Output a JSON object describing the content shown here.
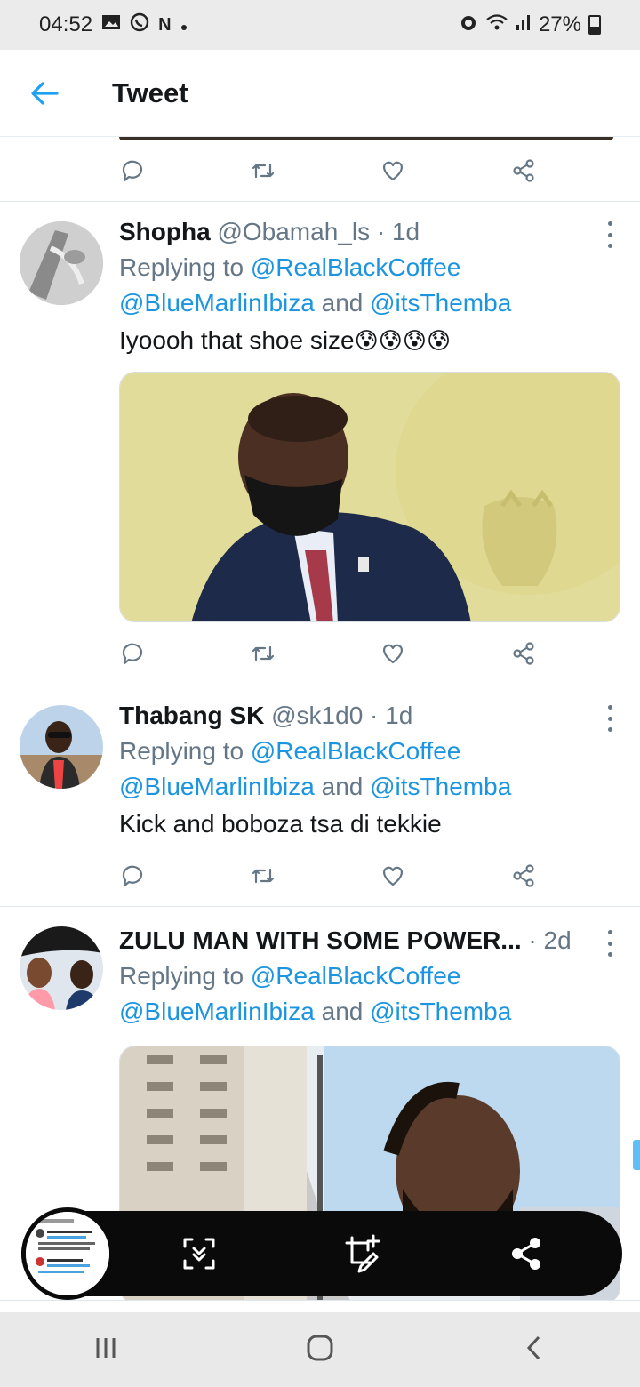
{
  "status": {
    "time": "04:52",
    "battery": "27%",
    "notif_letter": "N"
  },
  "header": {
    "title": "Tweet"
  },
  "tweets": [
    {
      "name": "Shopha",
      "handle": "@Obamah_ls",
      "time": "· 1d",
      "reply_prefix": "Replying to",
      "mention1": "@RealBlackCoffee",
      "mention2": "@BlueMarlinIbiza",
      "and": "and",
      "mention3": "@itsThemba",
      "text": "Iyoooh that shoe size",
      "emoji": "😰😰😰😰"
    },
    {
      "name": "Thabang SK",
      "handle": "@sk1d0",
      "time": "· 1d",
      "reply_prefix": "Replying to",
      "mention1": "@RealBlackCoffee",
      "mention2": "@BlueMarlinIbiza",
      "and": "and",
      "mention3": "@itsThemba",
      "text": "Kick and boboza tsa di tekkie"
    },
    {
      "name": "ZULU MAN WITH SOME POWER...",
      "handle": "",
      "time": "· 2d",
      "reply_prefix": "Replying to",
      "mention1": "@RealBlackCoffee",
      "mention2": "@BlueMarlinIbiza",
      "and": "and",
      "mention3": "@itsThemba"
    }
  ],
  "icons": [
    "back-arrow-icon",
    "reply-icon",
    "retweet-icon",
    "like-icon",
    "share-icon",
    "more-icon",
    "scroll-capture-icon",
    "crop-edit-icon",
    "share-screenshot-icon",
    "recents-icon",
    "home-icon",
    "back-nav-icon"
  ],
  "colors": {
    "accent": "#1da1f2",
    "mention": "#1b95e0",
    "muted": "#657786"
  }
}
